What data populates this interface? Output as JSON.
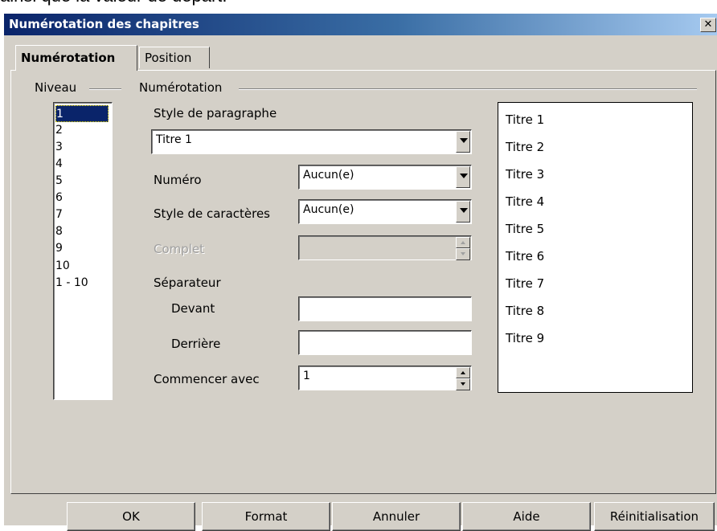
{
  "bg_text": "ainsi que la valeur de départ.",
  "dialog": {
    "title": "Numérotation des chapitres",
    "close_label": "✕"
  },
  "tabs": [
    {
      "label": "Numérotation",
      "active": true
    },
    {
      "label": "Position",
      "active": false
    }
  ],
  "level_group": {
    "title": "Niveau",
    "items": [
      "1",
      "2",
      "3",
      "4",
      "5",
      "6",
      "7",
      "8",
      "9",
      "10",
      "1 - 10"
    ],
    "selected": "1"
  },
  "numbering_group": {
    "title": "Numérotation",
    "paragraph_style_label": "Style de paragraphe",
    "paragraph_style_value": "Titre 1",
    "number_label": "Numéro",
    "number_value": "Aucun(e)",
    "char_style_label": "Style de caractères",
    "char_style_value": "Aucun(e)",
    "complete_label": "Complet",
    "complete_value": "",
    "separator_label": "Séparateur",
    "before_label": "Devant",
    "before_value": "",
    "after_label": "Derrière",
    "after_value": "",
    "start_label": "Commencer avec",
    "start_value": "1"
  },
  "preview": {
    "items": [
      "Titre 1",
      "Titre 2",
      "Titre 3",
      "Titre 4",
      "Titre 5",
      "Titre 6",
      "Titre 7",
      "Titre 8",
      "Titre 9"
    ]
  },
  "buttons": {
    "ok": "OK",
    "format": "Format",
    "cancel": "Annuler",
    "help": "Aide",
    "reset": "Réinitialisation"
  },
  "colors": {
    "titlebar": "#0a246a",
    "dialog_bg": "#d4d0c8",
    "selection": "#0a246a"
  }
}
